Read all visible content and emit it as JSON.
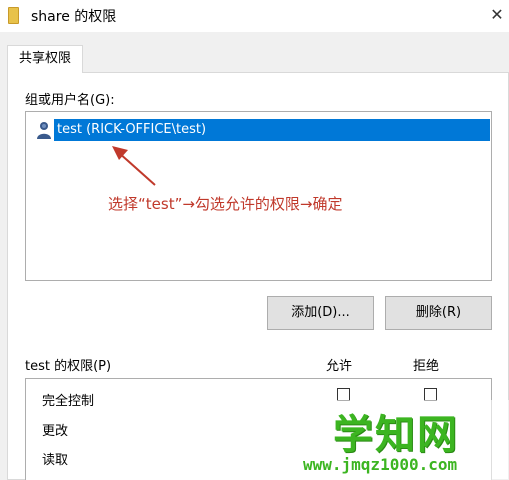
{
  "window": {
    "title": "share 的权限",
    "close_glyph": "✕"
  },
  "tabs": [
    {
      "label": "共享权限",
      "selected": true
    }
  ],
  "groups": {
    "label": "组或用户名(G):",
    "items": [
      {
        "name": "test (RICK-OFFICE\\test)",
        "icon": "user-icon",
        "selected": true
      }
    ]
  },
  "annotation": {
    "text": "选择“test”→勾选允许的权限→确定",
    "color": "#c0392b"
  },
  "buttons": {
    "add_label": "添加(D)...",
    "remove_label": "删除(R)"
  },
  "permissions": {
    "title": "test 的权限(P)",
    "col_allow": "允许",
    "col_deny": "拒绝",
    "rows": [
      {
        "label": "完全控制",
        "allow": false,
        "deny": false
      },
      {
        "label": "更改",
        "allow": false,
        "deny": false
      },
      {
        "label": "读取",
        "allow": false,
        "deny": false
      }
    ]
  },
  "watermark": {
    "brand": "学知网",
    "url": "www.jmqz1000.com"
  },
  "colors": {
    "selection": "#0078d7",
    "watermark": "#3cb521"
  }
}
